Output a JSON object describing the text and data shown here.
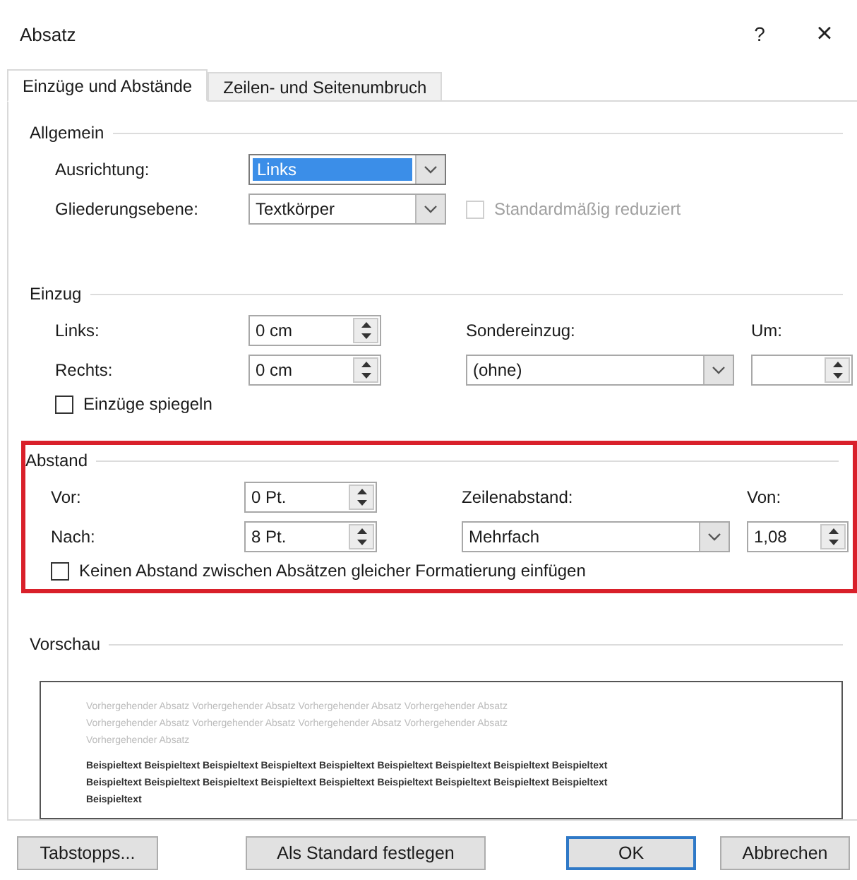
{
  "window": {
    "title": "Absatz",
    "help": "?",
    "close": "×"
  },
  "tabs": [
    {
      "label": "Einzüge und Abstände",
      "selected": true
    },
    {
      "label": "Zeilen- und Seitenumbruch",
      "selected": false
    }
  ],
  "general": {
    "heading": "Allgemein",
    "alignment": {
      "label": "Ausrichtung:",
      "value": "Links",
      "focused": true
    },
    "outline_level": {
      "label": "Gliederungsebene:",
      "value": "Textkörper",
      "focused": false
    },
    "collapsed": {
      "label": "Standardmäßig reduziert",
      "checked": false,
      "disabled": true
    }
  },
  "indent": {
    "heading": "Einzug",
    "left": {
      "label": "Links:",
      "value": "0 cm"
    },
    "right": {
      "label": "Rechts:",
      "value": "0 cm"
    },
    "special": {
      "label": "Sondereinzug:",
      "value": "(ohne)",
      "focused": false
    },
    "by": {
      "label": "Um:"
    },
    "mirror": {
      "label": "Einzüge spiegeln",
      "checked": false,
      "disabled": false
    }
  },
  "spacing": {
    "heading": "Abstand",
    "highlighted": true,
    "before": {
      "label": "Vor:",
      "value": "0 Pt."
    },
    "after": {
      "label": "Nach:",
      "value": "8 Pt."
    },
    "line_spacing": {
      "label": "Zeilenabstand:",
      "value": "Mehrfach",
      "focused": false
    },
    "at": {
      "label": "Von:",
      "value": "1,08"
    },
    "no_space": {
      "label": "Keinen Abstand zwischen Absätzen gleicher Formatierung einfügen",
      "checked": false,
      "disabled": false
    }
  },
  "preview": {
    "heading": "Vorschau",
    "previous_lines": [
      "Vorhergehender Absatz Vorhergehender Absatz Vorhergehender Absatz Vorhergehender Absatz",
      "Vorhergehender Absatz Vorhergehender Absatz Vorhergehender Absatz Vorhergehender Absatz",
      "Vorhergehender Absatz"
    ],
    "sample_lines": [
      "Beispieltext Beispieltext Beispieltext Beispieltext Beispieltext Beispieltext Beispieltext Beispieltext Beispieltext",
      "Beispieltext Beispieltext Beispieltext Beispieltext Beispieltext Beispieltext Beispieltext Beispieltext Beispieltext",
      "Beispieltext"
    ]
  },
  "buttons": [
    {
      "label": "Tabstopps...",
      "default": false
    },
    {
      "label": "Als Standard festlegen",
      "default": false
    },
    {
      "label": "OK",
      "default": true
    },
    {
      "label": "Abbrechen",
      "default": false
    }
  ]
}
